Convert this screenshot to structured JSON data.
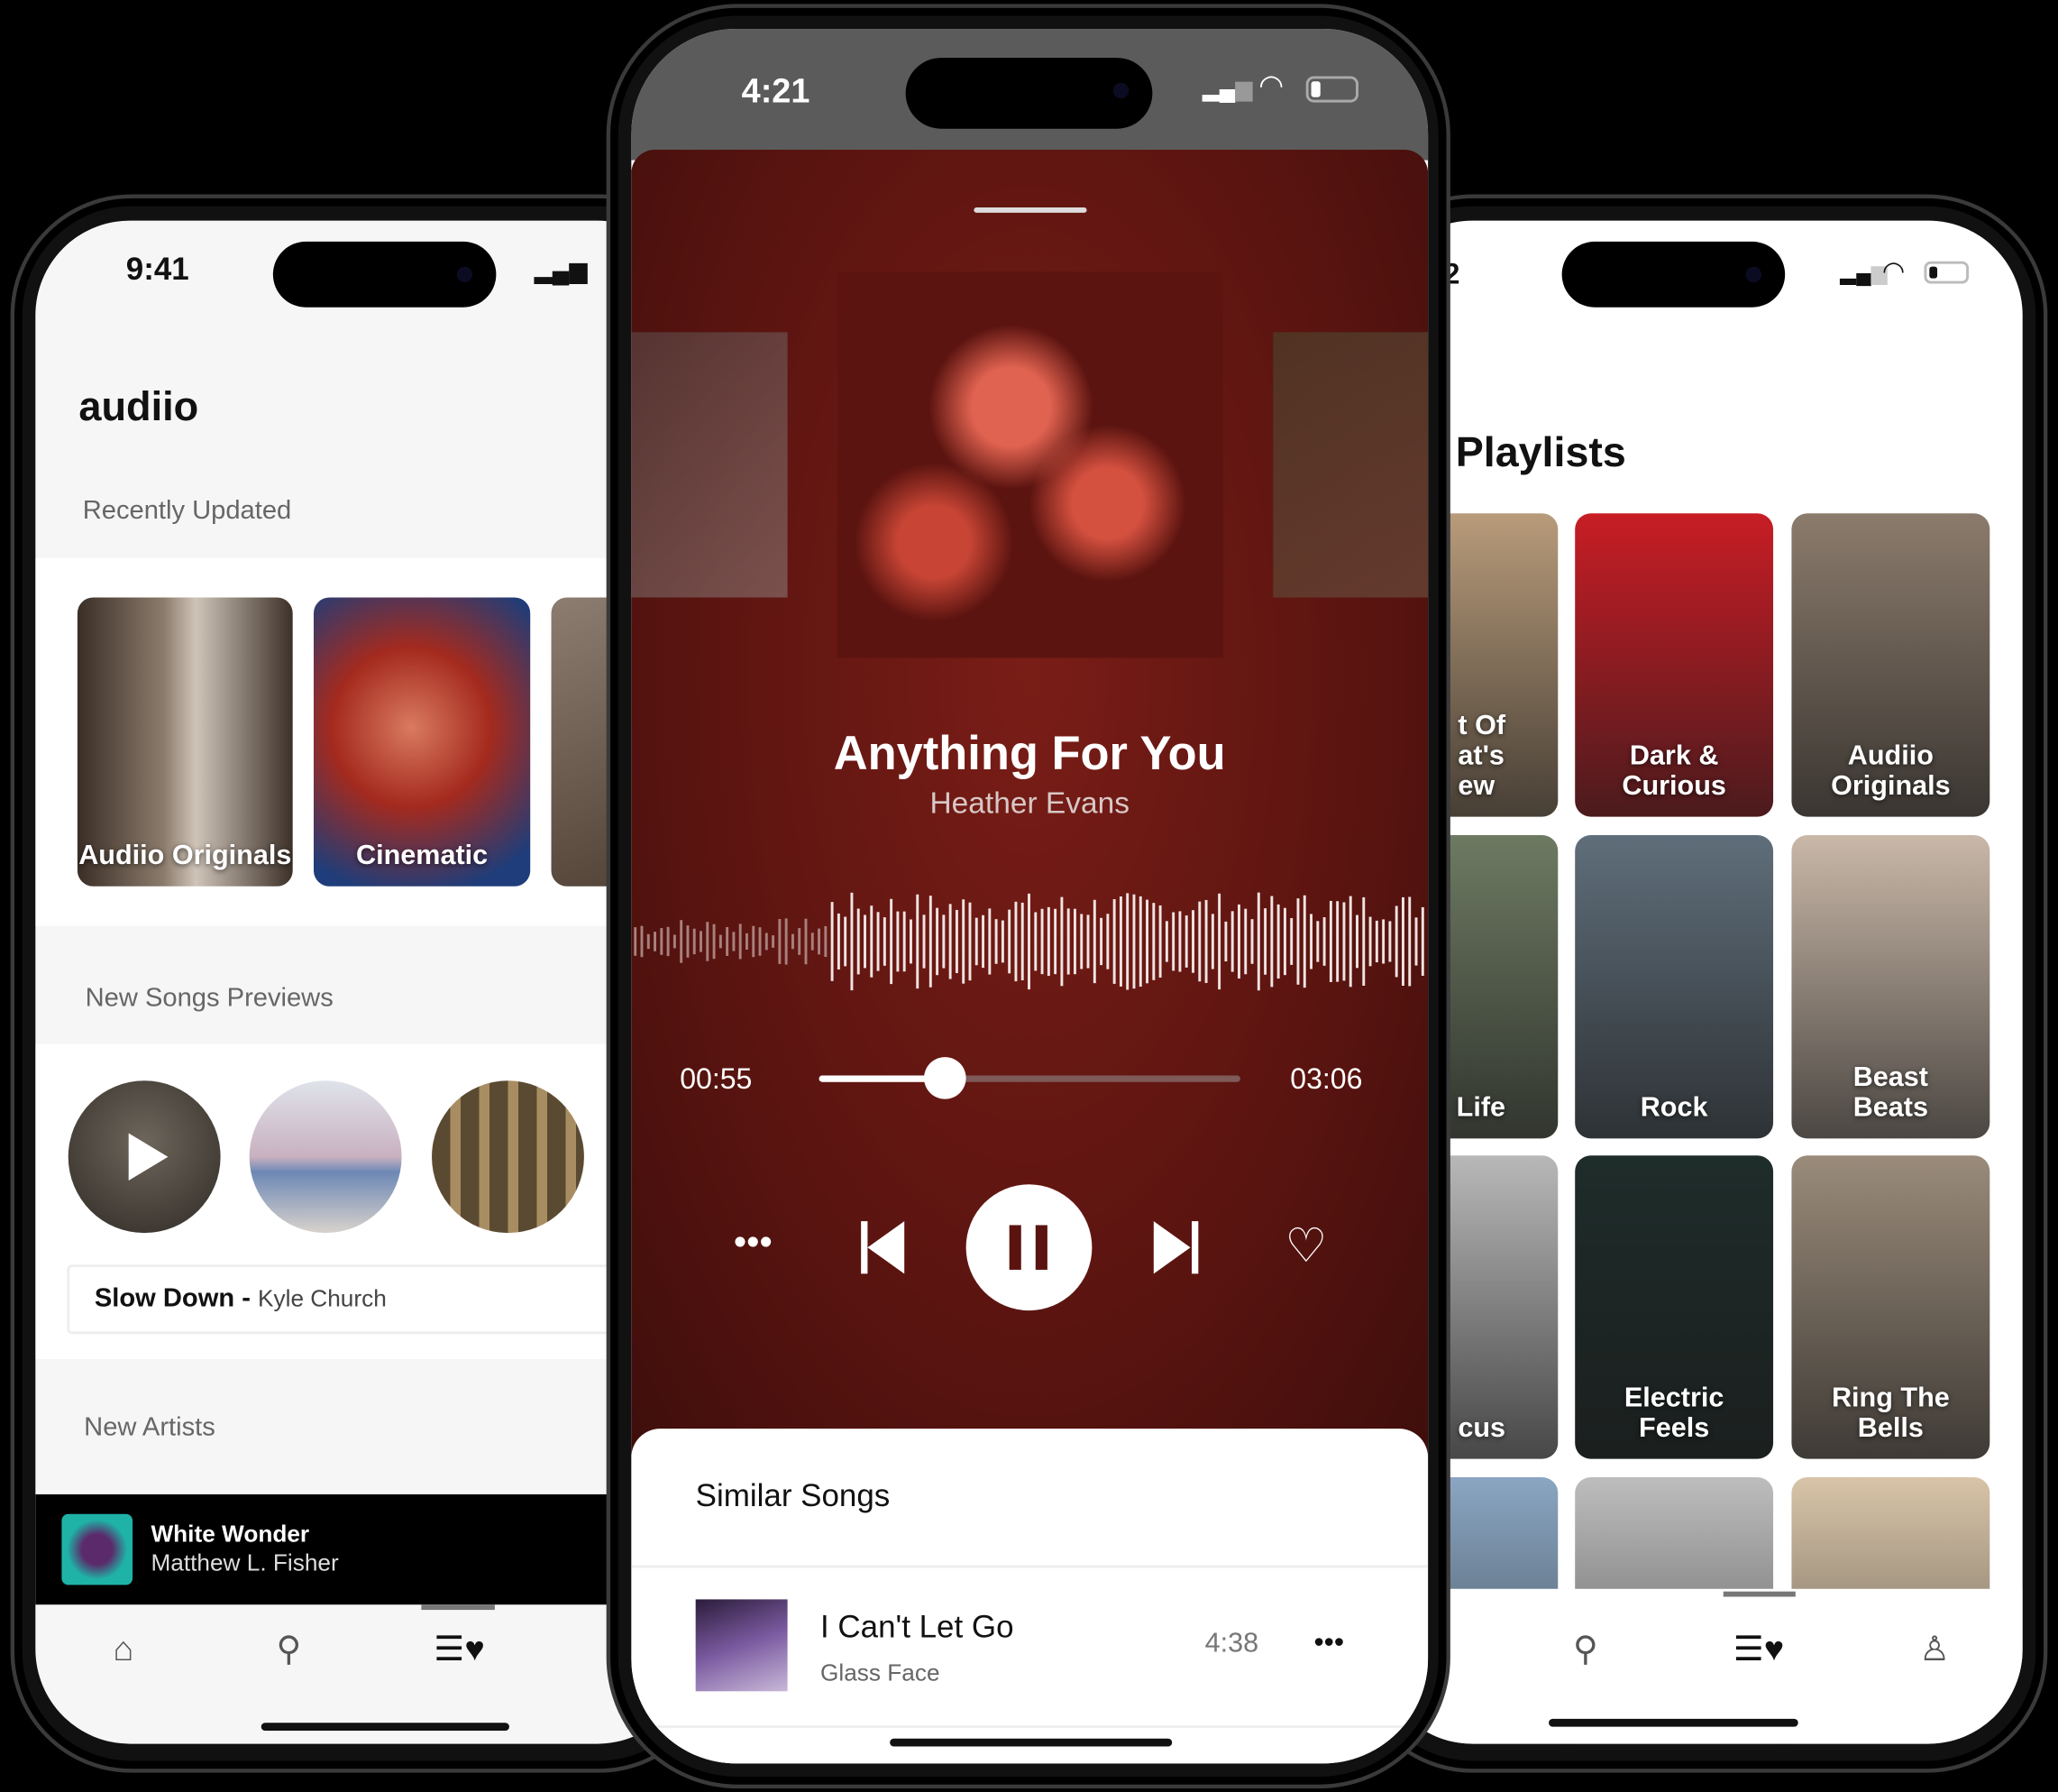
{
  "left_phone": {
    "status_time": "9:41",
    "app_title": "audiio",
    "recently_updated": {
      "heading": "Recently Updated",
      "cards": [
        {
          "label": "Audiio Originals"
        },
        {
          "label": "Cinematic"
        },
        {
          "label": ""
        }
      ]
    },
    "new_songs": {
      "heading": "New Songs Previews",
      "now_preview_title": "Slow Down",
      "separator": " - ",
      "now_preview_artist": "Kyle Church"
    },
    "new_artists_heading": "New Artists",
    "mini_player": {
      "title": "White Wonder",
      "artist": "Matthew L. Fisher"
    },
    "tabs": [
      "home-icon",
      "search-icon",
      "playlist-heart-icon"
    ],
    "active_tab": "playlist-heart-icon"
  },
  "center_phone": {
    "status_time": "4:21",
    "track": {
      "title": "Anything For You",
      "artist": "Heather Evans"
    },
    "elapsed": "00:55",
    "duration": "03:06",
    "progress_fraction": 0.3,
    "controls": [
      "more-icon",
      "previous-icon",
      "pause-icon",
      "next-icon",
      "heart-icon"
    ],
    "accent_color": "#8a1a14",
    "similar": {
      "heading": "Similar Songs",
      "items": [
        {
          "title": "I Can't Let Go",
          "artist": "Glass Face",
          "duration": "4:38"
        }
      ]
    }
  },
  "right_phone": {
    "status_time_fragment": "2",
    "title": "Playlists",
    "playlists": [
      [
        "t Of\nat's\new",
        "Dark &\nCurious",
        "Audiio\nOriginals"
      ],
      [
        "Life",
        "Rock",
        "Beast\nBeats"
      ],
      [
        "cus",
        "Electric\nFeels",
        "Ring The\nBells"
      ],
      [
        "",
        "",
        ""
      ]
    ],
    "tabs": [
      "search-icon",
      "playlist-heart-icon",
      "profile-icon"
    ],
    "active_tab": "playlist-heart-icon"
  }
}
